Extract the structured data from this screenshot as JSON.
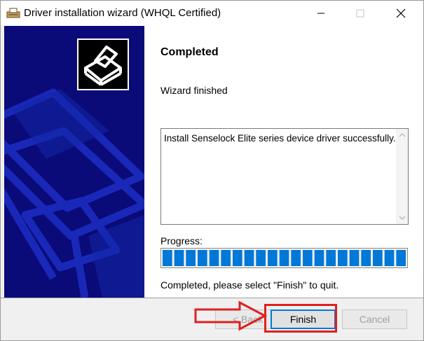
{
  "window": {
    "title": "Driver installation wizard (WHQL Certified)"
  },
  "page": {
    "heading": "Completed",
    "subtext": "Wizard finished",
    "log_text": "Install Senselock Elite series device driver successfully.",
    "progress_label": "Progress:",
    "progress_value": 1.0,
    "progress_segments": 21,
    "status_text": "Completed, please select \"Finish\" to quit."
  },
  "buttons": {
    "back": "< Back",
    "finish": "Finish",
    "cancel": "Cancel"
  },
  "icons": {
    "app": "printer-icon",
    "minimize": "minimize-icon",
    "maximize": "maximize-icon",
    "close": "close-icon",
    "wizard": "printer-icon",
    "scroll_up": "chevron-up-icon",
    "scroll_down": "chevron-down-icon",
    "annotation": "arrow-right-icon"
  },
  "colors": {
    "side_panel": "#0a0a78",
    "progress_fill": "#0078d7",
    "highlight": "#e02020"
  }
}
